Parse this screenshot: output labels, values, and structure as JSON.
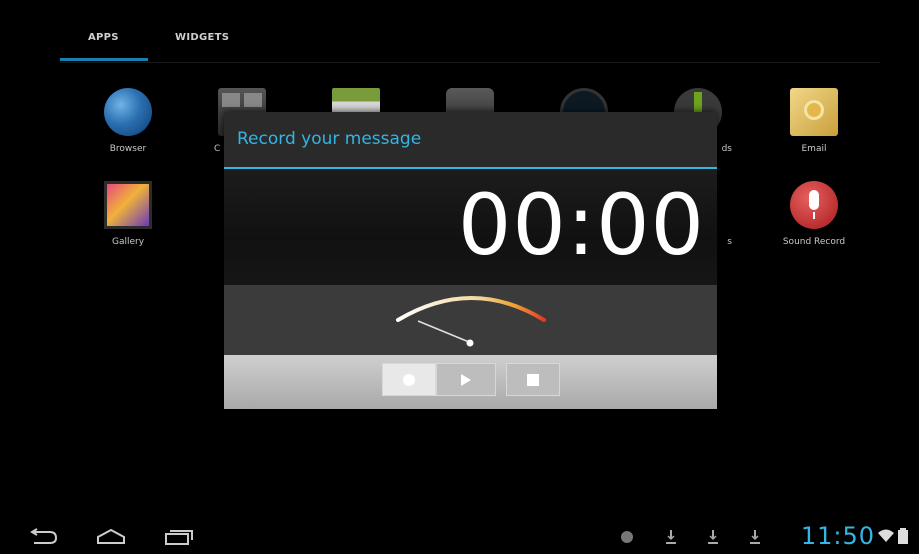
{
  "tabs": {
    "apps": "APPS",
    "widgets": "WIDGETS"
  },
  "apps": [
    {
      "label": "Browser",
      "icon": "browser-icon"
    },
    {
      "label": "C",
      "icon": "calculator-icon"
    },
    {
      "label": "",
      "icon": "calendar-icon"
    },
    {
      "label": "",
      "icon": "camera-icon"
    },
    {
      "label": "",
      "icon": "clock-icon"
    },
    {
      "label": "ds",
      "icon": "downloads-icon"
    },
    {
      "label": "Email",
      "icon": "email-icon"
    },
    {
      "label": "Gallery",
      "icon": "gallery-icon"
    },
    {
      "label": "s",
      "icon": "app-icon"
    },
    {
      "label": "Sound Record",
      "icon": "sound-recorder-icon"
    }
  ],
  "dialog": {
    "title": "Record your message",
    "timer": "00:00",
    "controls": [
      "record-icon",
      "play-icon",
      "stop-icon"
    ]
  },
  "status": {
    "time": "11:50"
  },
  "colors": {
    "accent": "#33b5e5",
    "tab_underline": "#1b7fb0",
    "meter_red": "#e23a2a"
  }
}
